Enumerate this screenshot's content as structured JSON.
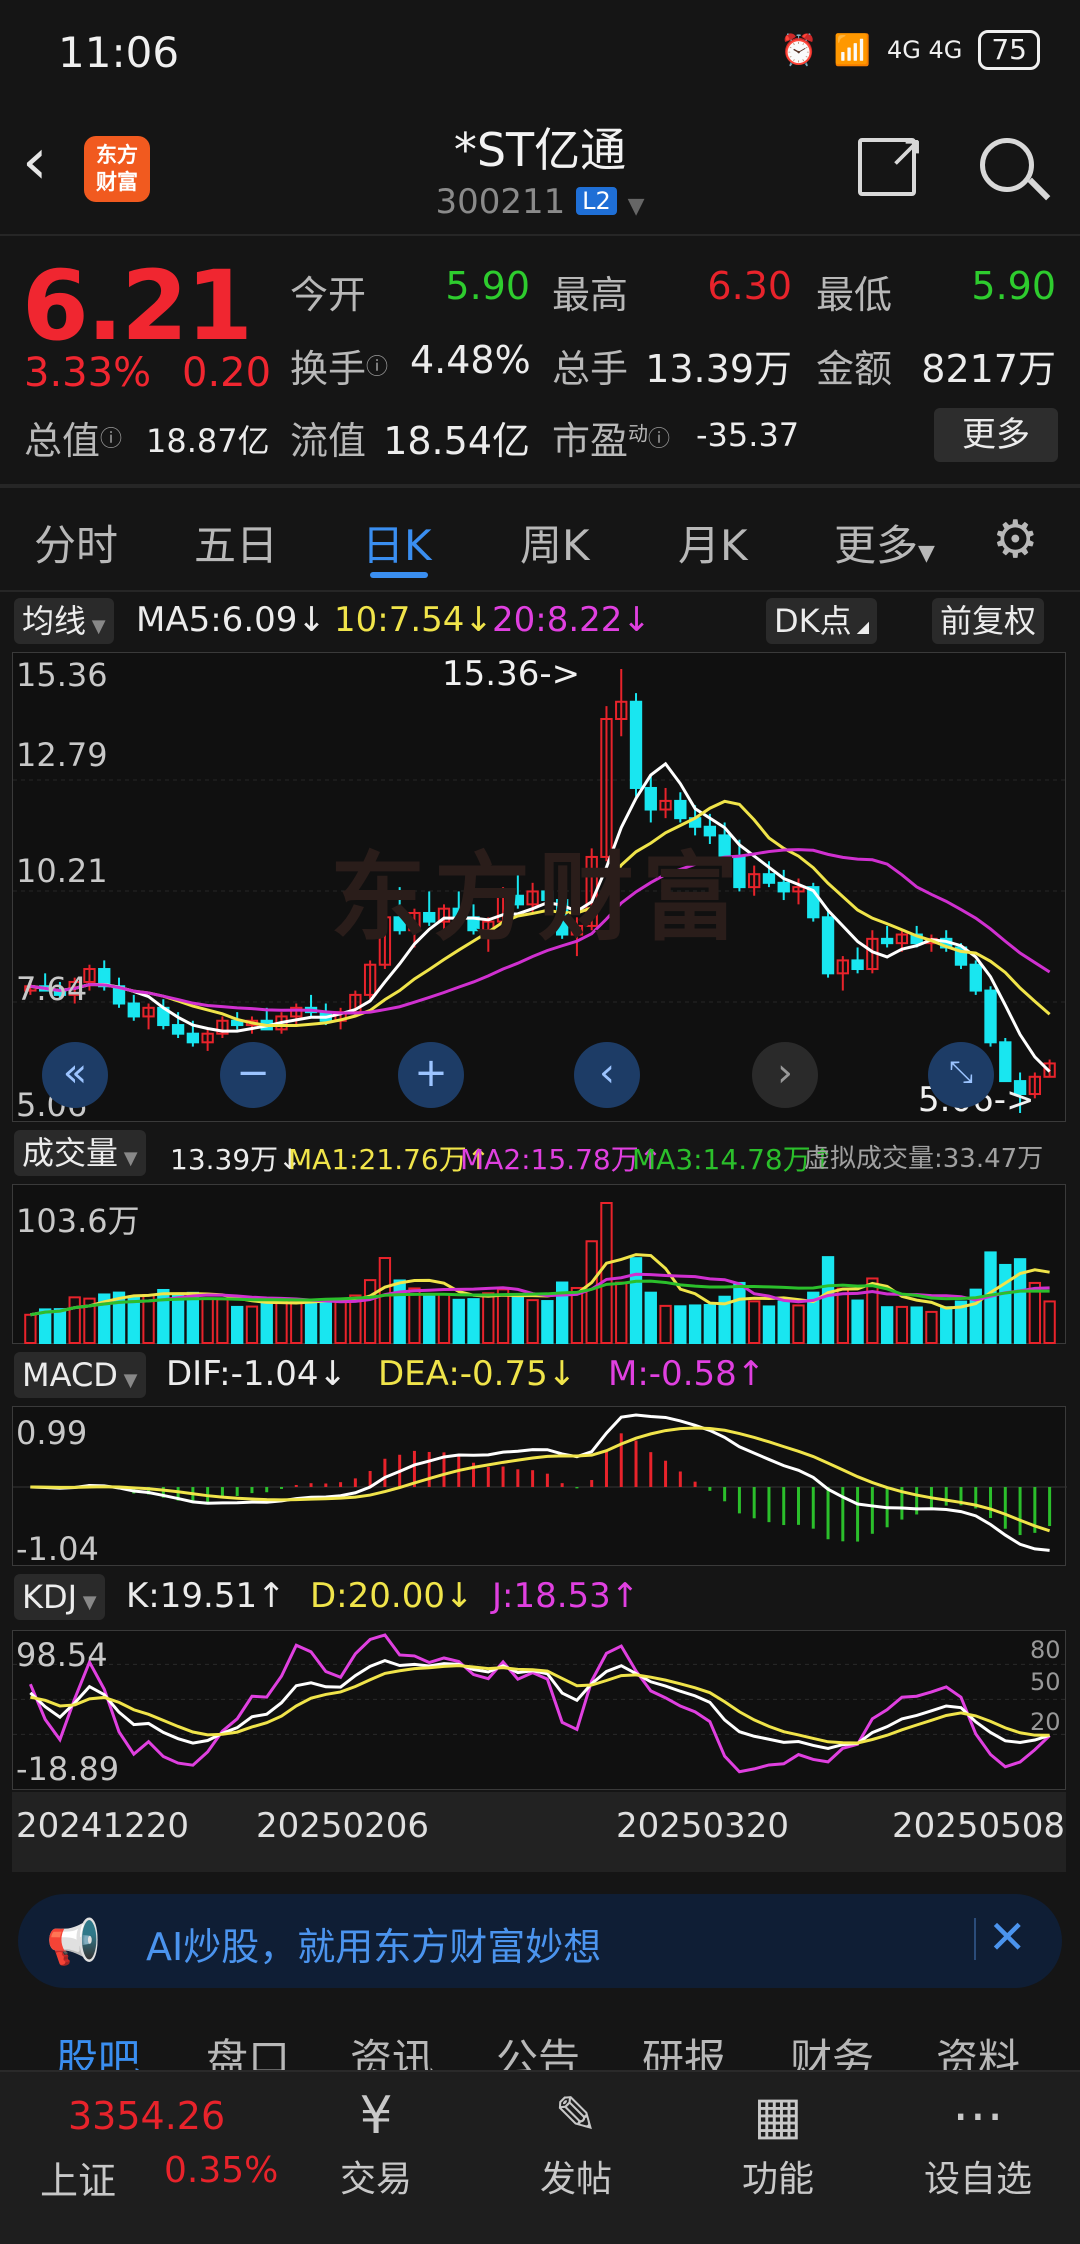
{
  "status_bar": {
    "time": "11:06",
    "network": "4G 4G",
    "battery": "75"
  },
  "header": {
    "app_logo": "东方\n财富",
    "stock_name": "*ST亿通",
    "stock_code": "300211",
    "level_badge": "L2"
  },
  "quote": {
    "price": "6.21",
    "change_pct": "3.33%",
    "change": "0.20",
    "market_cap_label": "总值",
    "market_cap": "18.87亿",
    "open_label": "今开",
    "open": "5.90",
    "high_label": "最高",
    "high": "6.30",
    "low_label": "最低",
    "low": "5.90",
    "turnover_label": "换手",
    "turnover": "4.48%",
    "volume_label": "总手",
    "volume": "13.39万",
    "amount_label": "金额",
    "amount": "8217万",
    "float_cap_label": "流值",
    "float_cap": "18.54亿",
    "pe_label": "市盈",
    "pe_sup": "动",
    "pe": "-35.37",
    "more_label": "更多"
  },
  "tabs": [
    "分时",
    "五日",
    "日K",
    "周K",
    "月K",
    "更多"
  ],
  "active_tab": "日K",
  "ma_row": {
    "selector": "均线",
    "ma5": "MA5:6.09↓",
    "ma10": "10:7.54↓",
    "ma20": "20:8.22↓",
    "dk_button": "DK点",
    "adjust_button": "前复权"
  },
  "kline": {
    "y_labels": [
      "15.36",
      "12.79",
      "10.21",
      "7.64",
      "5.06"
    ],
    "max_annotation": "15.36->",
    "min_annotation": "5.06->",
    "watermark": "东方财富"
  },
  "volume_row": {
    "selector": "成交量",
    "vol": "13.39万↓",
    "ma1": "MA1:21.76万↑",
    "ma2": "MA2:15.78万↑",
    "ma3": "MA3:14.78万↑",
    "virtual": "虚拟成交量:33.47万",
    "y_max": "103.6万"
  },
  "macd_row": {
    "selector": "MACD",
    "dif": "DIF:-1.04↓",
    "dea": "DEA:-0.75↓",
    "m": "M:-0.58↑",
    "y_top": "0.99",
    "y_bottom": "-1.04"
  },
  "kdj_row": {
    "selector": "KDJ",
    "k": "K:19.51↑",
    "d": "D:20.00↓",
    "j": "J:18.53↑",
    "y_top": "98.54",
    "y_bottom": "-18.89",
    "right_labels": [
      "80",
      "50",
      "20"
    ]
  },
  "dates": [
    "20241220",
    "20250206",
    "20250320",
    "20250508"
  ],
  "chart_data": {
    "type": "candlestick",
    "price_range": [
      5.06,
      15.36
    ],
    "candles": [
      [
        7.9,
        8.1,
        7.8,
        8.0
      ],
      [
        8.0,
        8.3,
        7.9,
        7.9
      ],
      [
        7.9,
        8.1,
        7.7,
        7.8
      ],
      [
        7.8,
        8.2,
        7.6,
        8.1
      ],
      [
        8.1,
        8.5,
        7.9,
        8.4
      ],
      [
        8.4,
        8.6,
        7.9,
        8.0
      ],
      [
        8.0,
        8.2,
        7.5,
        7.6
      ],
      [
        7.6,
        7.8,
        7.2,
        7.3
      ],
      [
        7.3,
        7.6,
        7.0,
        7.5
      ],
      [
        7.5,
        7.7,
        7.0,
        7.1
      ],
      [
        7.1,
        7.4,
        6.8,
        6.9
      ],
      [
        6.9,
        7.2,
        6.6,
        6.7
      ],
      [
        6.7,
        7.0,
        6.5,
        6.9
      ],
      [
        6.9,
        7.3,
        6.8,
        7.2
      ],
      [
        7.2,
        7.4,
        7.0,
        7.1
      ],
      [
        7.1,
        7.3,
        6.9,
        7.2
      ],
      [
        7.2,
        7.5,
        7.0,
        7.0
      ],
      [
        7.0,
        7.4,
        6.9,
        7.3
      ],
      [
        7.3,
        7.6,
        7.1,
        7.5
      ],
      [
        7.5,
        7.8,
        7.3,
        7.4
      ],
      [
        7.4,
        7.6,
        7.1,
        7.2
      ],
      [
        7.2,
        7.5,
        7.0,
        7.4
      ],
      [
        7.4,
        7.9,
        7.3,
        7.8
      ],
      [
        7.8,
        8.6,
        7.7,
        8.5
      ],
      [
        8.5,
        9.8,
        8.4,
        9.6
      ],
      [
        9.6,
        10.3,
        9.2,
        9.3
      ],
      [
        9.3,
        9.8,
        8.9,
        9.7
      ],
      [
        9.7,
        10.2,
        9.4,
        9.5
      ],
      [
        9.5,
        9.9,
        9.1,
        9.8
      ],
      [
        9.8,
        10.2,
        9.5,
        9.6
      ],
      [
        9.6,
        9.9,
        9.2,
        9.3
      ],
      [
        9.3,
        9.6,
        8.8,
        9.5
      ],
      [
        9.5,
        10.3,
        9.4,
        10.1
      ],
      [
        10.1,
        10.6,
        9.8,
        9.9
      ],
      [
        9.9,
        10.4,
        9.7,
        10.2
      ],
      [
        10.2,
        10.6,
        9.9,
        10.0
      ],
      [
        10.0,
        10.2,
        9.1,
        9.2
      ],
      [
        9.2,
        9.6,
        8.7,
        9.4
      ],
      [
        9.4,
        11.2,
        9.3,
        11.0
      ],
      [
        11.0,
        14.5,
        10.9,
        14.2
      ],
      [
        14.2,
        15.36,
        13.8,
        14.6
      ],
      [
        14.6,
        14.8,
        12.4,
        12.6
      ],
      [
        12.6,
        12.9,
        11.8,
        12.1
      ],
      [
        12.1,
        12.6,
        11.9,
        12.3
      ],
      [
        12.3,
        12.5,
        11.8,
        11.9
      ],
      [
        11.9,
        12.2,
        11.5,
        11.7
      ],
      [
        11.7,
        12.0,
        11.3,
        11.5
      ],
      [
        11.5,
        11.8,
        10.9,
        11.0
      ],
      [
        11.0,
        11.4,
        10.2,
        10.3
      ],
      [
        10.3,
        10.8,
        10.1,
        10.6
      ],
      [
        10.6,
        10.9,
        10.3,
        10.4
      ],
      [
        10.4,
        10.7,
        10.0,
        10.2
      ],
      [
        10.2,
        10.5,
        9.9,
        10.3
      ],
      [
        10.3,
        10.4,
        9.5,
        9.6
      ],
      [
        9.6,
        9.8,
        8.2,
        8.3
      ],
      [
        8.3,
        8.7,
        7.9,
        8.6
      ],
      [
        8.6,
        8.9,
        8.3,
        8.4
      ],
      [
        8.4,
        9.3,
        8.3,
        9.1
      ],
      [
        9.1,
        9.4,
        8.9,
        9.0
      ],
      [
        9.0,
        9.3,
        8.8,
        9.2
      ],
      [
        9.2,
        9.4,
        8.9,
        9.0
      ],
      [
        9.0,
        9.2,
        8.8,
        9.1
      ],
      [
        9.1,
        9.3,
        8.8,
        8.9
      ],
      [
        8.9,
        9.0,
        8.4,
        8.5
      ],
      [
        8.5,
        8.6,
        7.8,
        7.9
      ],
      [
        7.9,
        8.0,
        6.6,
        6.7
      ],
      [
        6.7,
        6.8,
        5.8,
        5.8
      ],
      [
        5.8,
        6.0,
        5.06,
        5.5
      ],
      [
        5.5,
        6.0,
        5.4,
        5.9
      ],
      [
        5.9,
        6.3,
        5.9,
        6.21
      ]
    ]
  }
}
